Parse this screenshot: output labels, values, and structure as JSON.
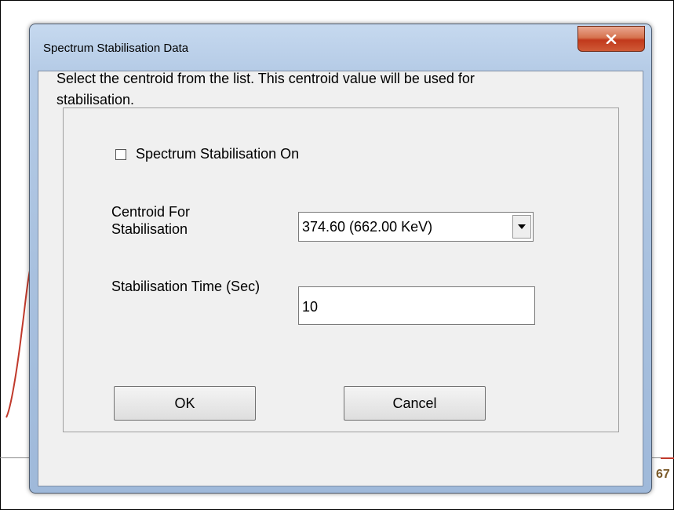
{
  "background": {
    "partial_text": "67"
  },
  "dialog": {
    "title": "Spectrum Stabilisation Data",
    "close_icon": "close-x-icon",
    "instructions": "Select the centroid from the list. This centroid value will be used for stabilisation.",
    "checkbox": {
      "label": "Spectrum Stabilisation On",
      "checked": false
    },
    "centroid": {
      "label": "Centroid For Stabilisation",
      "selected": "374.60 (662.00 KeV)"
    },
    "time": {
      "label": "Stabilisation Time (Sec)",
      "value": "10"
    },
    "buttons": {
      "ok": "OK",
      "cancel": "Cancel"
    }
  }
}
